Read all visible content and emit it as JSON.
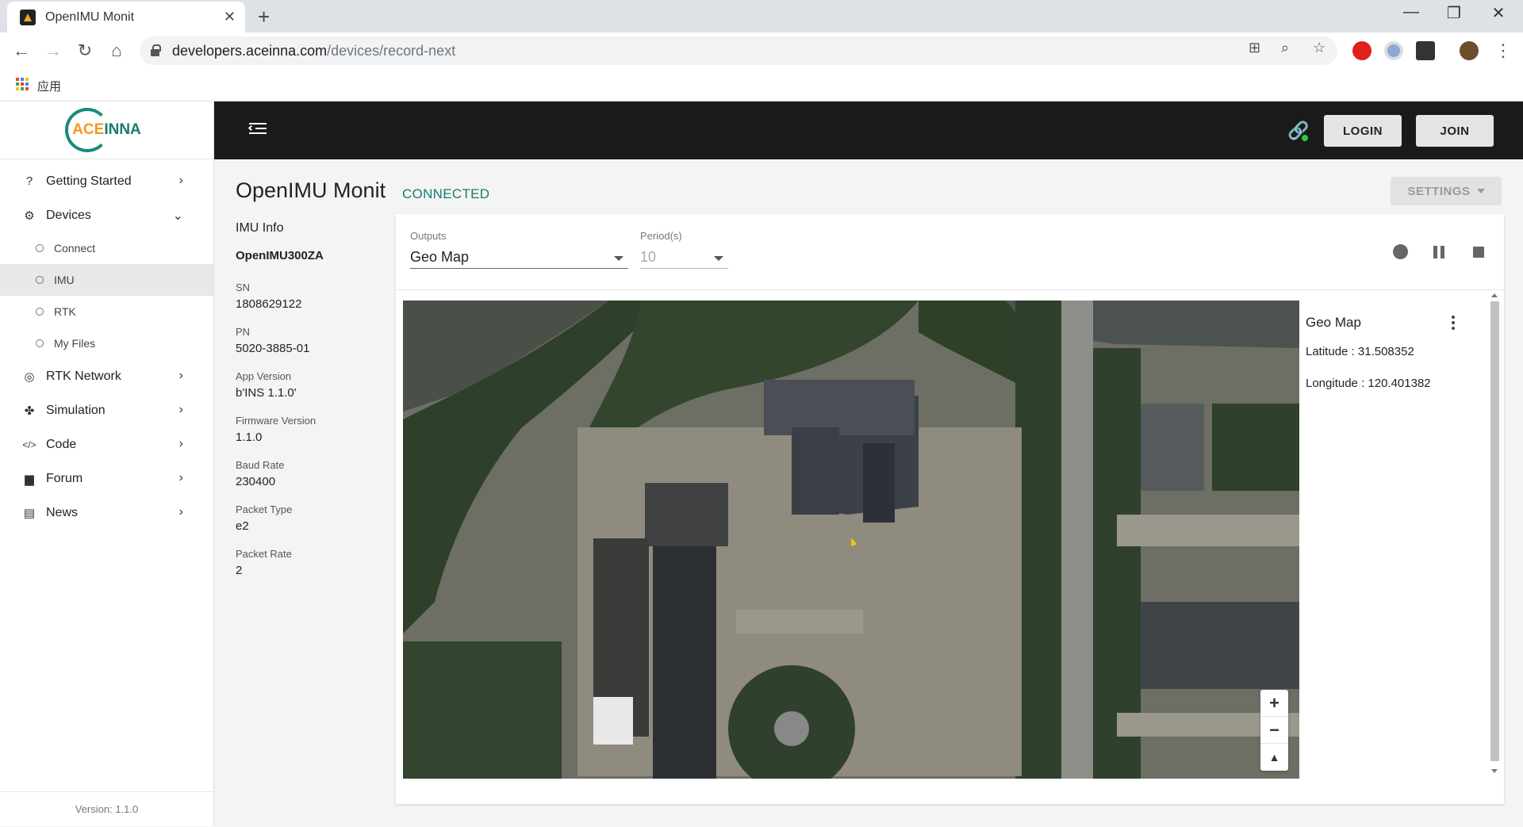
{
  "browser": {
    "tab_title": "OpenIMU Monit",
    "url_host": "developers.aceinna.com",
    "url_path": "/devices/record-next",
    "bookmark_apps_label": "应用"
  },
  "sidebar": {
    "logo_text_ac": "ACE",
    "logo_text_rest": "INNA",
    "items": [
      {
        "label": "Getting Started",
        "icon": "help-circle-icon"
      },
      {
        "label": "Devices",
        "icon": "chip-icon"
      },
      {
        "label": "RTK Network",
        "icon": "globe-icon"
      },
      {
        "label": "Simulation",
        "icon": "puzzle-icon"
      },
      {
        "label": "Code",
        "icon": "code-icon"
      },
      {
        "label": "Forum",
        "icon": "forum-icon"
      },
      {
        "label": "News",
        "icon": "news-icon"
      }
    ],
    "device_subitems": [
      {
        "label": "Connect"
      },
      {
        "label": "IMU"
      },
      {
        "label": "RTK"
      },
      {
        "label": "My Files"
      }
    ],
    "version": "Version: 1.1.0"
  },
  "header": {
    "login_label": "LOGIN",
    "join_label": "JOIN"
  },
  "main": {
    "title": "OpenIMU Monit",
    "status": "CONNECTED",
    "settings_label": "SETTINGS"
  },
  "imu_info": {
    "heading": "IMU Info",
    "model": "OpenIMU300ZA",
    "fields": [
      {
        "label": "SN",
        "value": "1808629122"
      },
      {
        "label": "PN",
        "value": "5020-3885-01"
      },
      {
        "label": "App Version",
        "value": "b'INS 1.1.0'"
      },
      {
        "label": "Firmware Version",
        "value": "1.1.0"
      },
      {
        "label": "Baud Rate",
        "value": "230400"
      },
      {
        "label": "Packet Type",
        "value": "e2"
      },
      {
        "label": "Packet Rate",
        "value": "2"
      }
    ]
  },
  "controls": {
    "outputs_label": "Outputs",
    "outputs_value": "Geo Map",
    "period_label": "Period(s)",
    "period_value": "10"
  },
  "geomap": {
    "title": "Geo Map",
    "latitude": "Latitude : 31.508352",
    "longitude": "Longitude : 120.401382",
    "zoom_in": "+",
    "zoom_out": "−"
  },
  "colors": {
    "accent_teal": "#1a7a6c",
    "logo_orange": "#f29a1f",
    "topbar": "#1a1a1a"
  }
}
